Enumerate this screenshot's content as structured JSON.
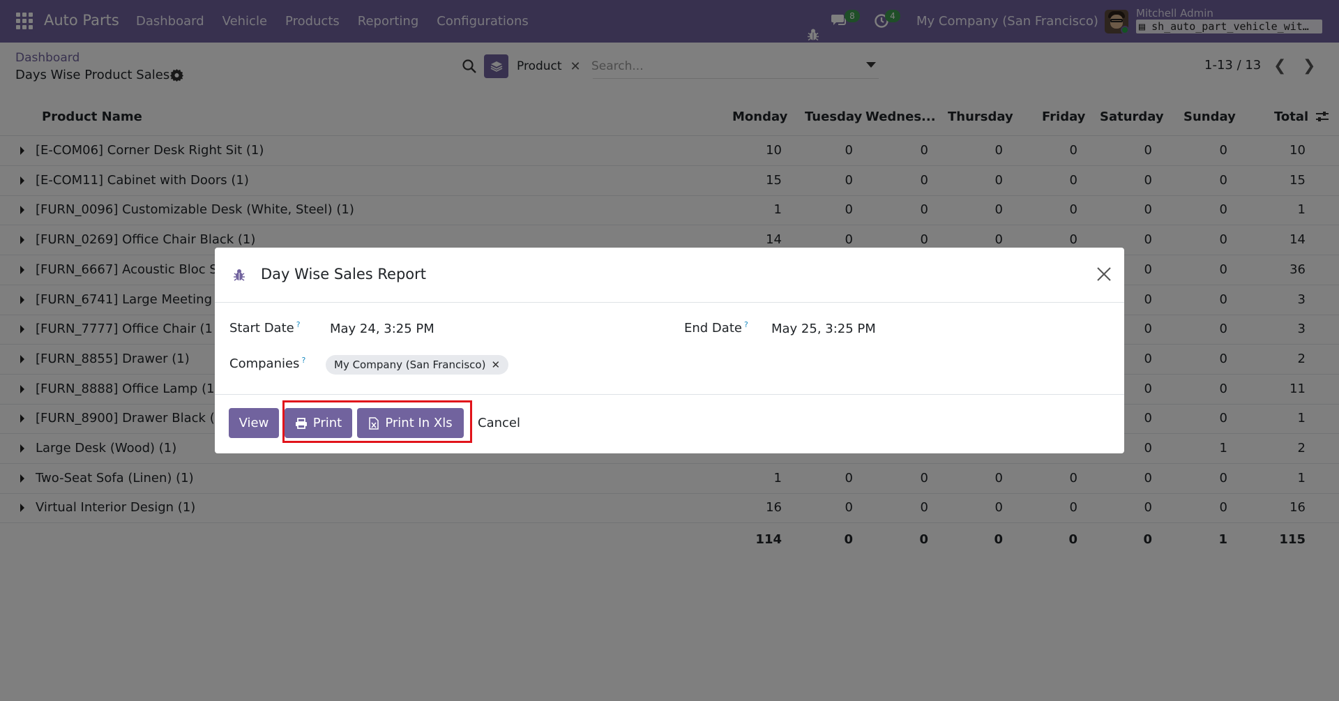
{
  "navbar": {
    "app_name": "Auto Parts",
    "menu": [
      "Dashboard",
      "Vehicle",
      "Products",
      "Reporting",
      "Configurations"
    ],
    "chat_badge": "8",
    "activity_badge": "4",
    "company": "My Company (San Francisco)",
    "user_name": "Mitchell Admin",
    "db_name": "sh_auto_part_vehicle_wit…"
  },
  "control": {
    "breadcrumb": "Dashboard",
    "title": "Days Wise Product Sales",
    "facet_label": "Product",
    "search_placeholder": "Search...",
    "pager": "1-13 / 13"
  },
  "table": {
    "columns": [
      "Product Name",
      "Monday",
      "Tuesday",
      "Wednes...",
      "Thursday",
      "Friday",
      "Saturday",
      "Sunday",
      "Total"
    ],
    "rows": [
      {
        "name": "[E-COM06] Corner Desk Right Sit (1)",
        "values": [
          "10",
          "0",
          "0",
          "0",
          "0",
          "0",
          "0",
          "10"
        ]
      },
      {
        "name": "[E-COM11] Cabinet with Doors (1)",
        "values": [
          "15",
          "0",
          "0",
          "0",
          "0",
          "0",
          "0",
          "15"
        ]
      },
      {
        "name": "[FURN_0096] Customizable Desk (White, Steel) (1)",
        "values": [
          "1",
          "0",
          "0",
          "0",
          "0",
          "0",
          "0",
          "1"
        ]
      },
      {
        "name": "[FURN_0269] Office Chair Black (1)",
        "values": [
          "14",
          "0",
          "0",
          "0",
          "0",
          "0",
          "0",
          "14"
        ]
      },
      {
        "name": "[FURN_6667] Acoustic Bloc S",
        "values": [
          "",
          "",
          "",
          "",
          "",
          "0",
          "0",
          "36"
        ]
      },
      {
        "name": "[FURN_6741] Large Meeting",
        "values": [
          "",
          "",
          "",
          "",
          "",
          "0",
          "0",
          "3"
        ]
      },
      {
        "name": "[FURN_7777] Office Chair (1",
        "values": [
          "",
          "",
          "",
          "",
          "",
          "0",
          "0",
          "3"
        ]
      },
      {
        "name": "[FURN_8855] Drawer (1)",
        "values": [
          "",
          "",
          "",
          "",
          "",
          "0",
          "0",
          "2"
        ]
      },
      {
        "name": "[FURN_8888] Office Lamp (1",
        "values": [
          "",
          "",
          "",
          "",
          "",
          "0",
          "0",
          "11"
        ]
      },
      {
        "name": "[FURN_8900] Drawer Black (",
        "values": [
          "",
          "",
          "",
          "",
          "",
          "0",
          "0",
          "1"
        ]
      },
      {
        "name": "Large Desk (Wood) (1)",
        "values": [
          "",
          "",
          "",
          "",
          "",
          "0",
          "1",
          "2"
        ]
      },
      {
        "name": "Two-Seat Sofa (Linen) (1)",
        "values": [
          "1",
          "0",
          "0",
          "0",
          "0",
          "0",
          "0",
          "1"
        ]
      },
      {
        "name": "Virtual Interior Design (1)",
        "values": [
          "16",
          "0",
          "0",
          "0",
          "0",
          "0",
          "0",
          "16"
        ]
      }
    ],
    "totals": [
      "114",
      "0",
      "0",
      "0",
      "0",
      "0",
      "1",
      "115"
    ]
  },
  "modal": {
    "title": "Day Wise Sales Report",
    "start_label": "Start Date",
    "start_value": "May 24, 3:25 PM",
    "end_label": "End Date",
    "end_value": "May 25, 3:25 PM",
    "companies_label": "Companies",
    "company_tag": "My Company (San Francisco)",
    "help_mark": "?",
    "view_label": "View",
    "print_label": "Print",
    "print_xls_label": "Print In Xls",
    "cancel_label": "Cancel"
  },
  "colors": {
    "primary": "#71639e",
    "badge": "#3f9c50",
    "highlight": "#e1141b"
  }
}
